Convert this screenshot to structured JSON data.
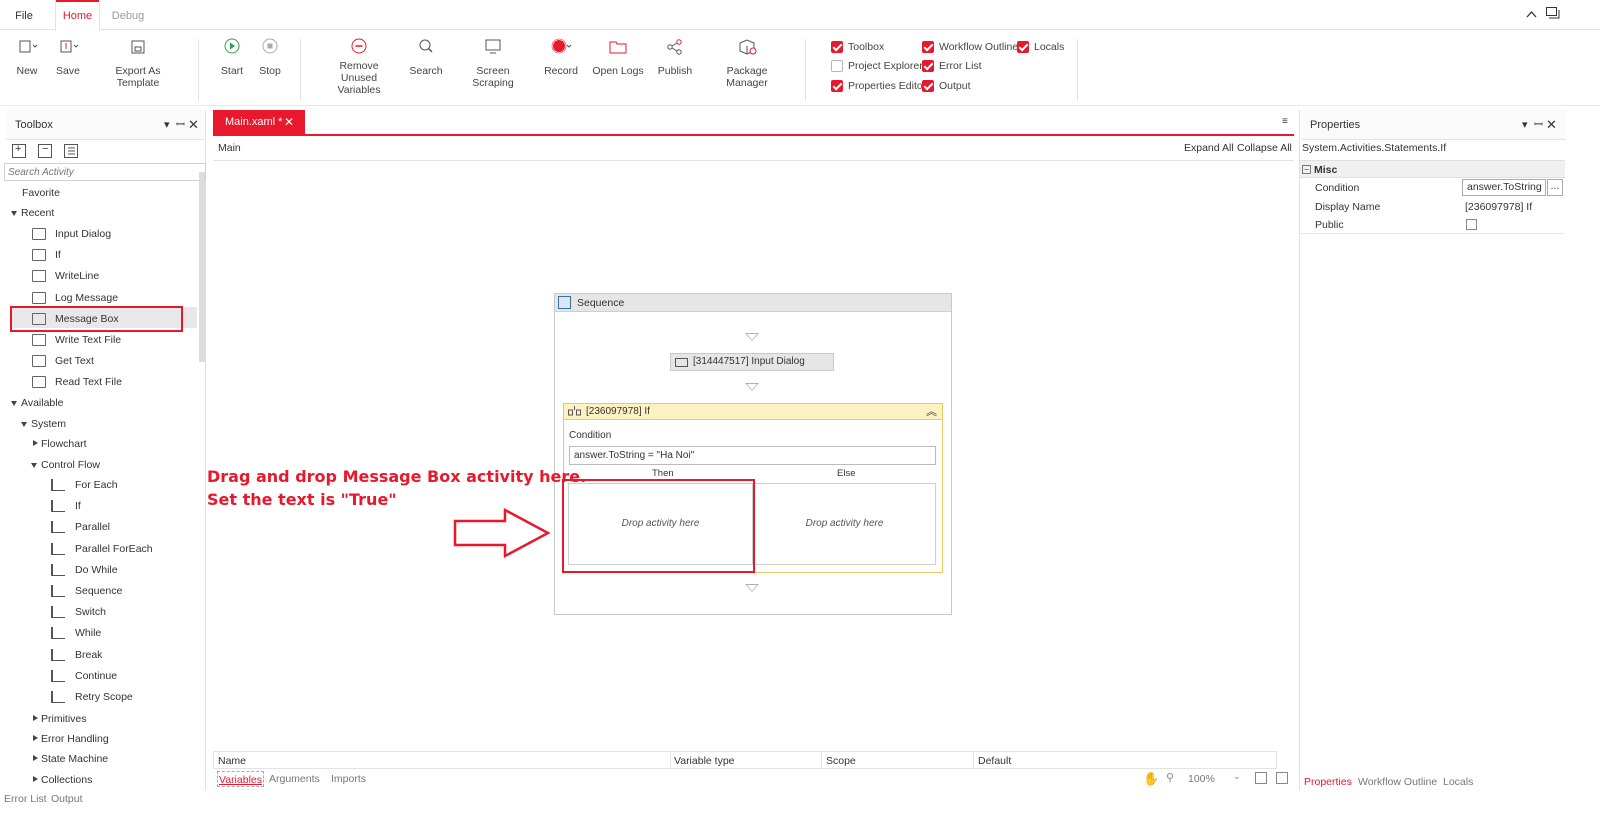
{
  "menu": {
    "file": "File",
    "home": "Home",
    "debug": "Debug"
  },
  "ribbon": {
    "new": "New",
    "save": "Save",
    "export": "Export As Template",
    "start": "Start",
    "stop": "Stop",
    "remove_unused_1": "Remove Unused",
    "remove_unused_2": "Variables",
    "search": "Search",
    "screen_scraping": "Screen Scraping",
    "record": "Record",
    "open_logs": "Open Logs",
    "publish": "Publish",
    "package_manager": "Package Manager"
  },
  "panels_toggle": {
    "toolbox": "Toolbox",
    "workflow_outline": "Workflow Outline",
    "locals": "Locals",
    "project_explorer": "Project Explorer",
    "error_list": "Error List",
    "properties_editor": "Properties Editor",
    "output": "Output"
  },
  "toolbox": {
    "title": "Toolbox",
    "search_placeholder": "Search Activity",
    "favorite": "Favorite",
    "recent": "Recent",
    "recent_items": [
      "Input Dialog",
      "If",
      "WriteLine",
      "Log Message",
      "Message Box",
      "Write Text File",
      "Get Text",
      "Read Text File"
    ],
    "available": "Available",
    "system": "System",
    "flowchart": "Flowchart",
    "control_flow": "Control Flow",
    "control_flow_items": [
      "For Each",
      "If",
      "Parallel",
      "Parallel ForEach",
      "Do While",
      "Sequence",
      "Switch",
      "While",
      "Break",
      "Continue",
      "Retry Scope"
    ],
    "primitives": "Primitives",
    "error_handling": "Error Handling",
    "state_machine": "State Machine",
    "collections": "Collections"
  },
  "designer": {
    "tab": "Main.xaml *",
    "breadcrumb": "Main",
    "expand_all": "Expand All",
    "collapse_all": "Collapse All",
    "sequence_title": "Sequence",
    "input_dialog": "[314447517] Input Dialog",
    "if_title": "[236097978] If",
    "condition_label": "Condition",
    "condition_value": "answer.ToString = \"Ha Noi\"",
    "then_label": "Then",
    "else_label": "Else",
    "drop_then": "Drop activity here",
    "drop_else": "Drop activity here"
  },
  "annotation": {
    "line1": "Drag and drop Message Box activity here.",
    "line2": "Set the text is \"True\""
  },
  "variables": {
    "col_name": "Name",
    "col_type": "Variable type",
    "col_scope": "Scope",
    "col_default": "Default",
    "tab_variables": "Variables",
    "tab_arguments": "Arguments",
    "tab_imports": "Imports",
    "zoom": "100%"
  },
  "properties": {
    "title": "Properties",
    "type_name": "System.Activities.Statements.If",
    "category": "Misc",
    "condition_label": "Condition",
    "condition_value": "answer.ToString =",
    "display_name_label": "Display Name",
    "display_name_value": "[236097978] If",
    "public_label": "Public",
    "tab_properties": "Properties",
    "tab_workflow_outline": "Workflow Outline",
    "tab_locals": "Locals"
  },
  "bottom": {
    "error_list": "Error List",
    "output": "Output"
  },
  "colors": {
    "accent": "#e8192c",
    "if_header": "#fff2c2",
    "sequence_header": "#e6e6e6"
  }
}
